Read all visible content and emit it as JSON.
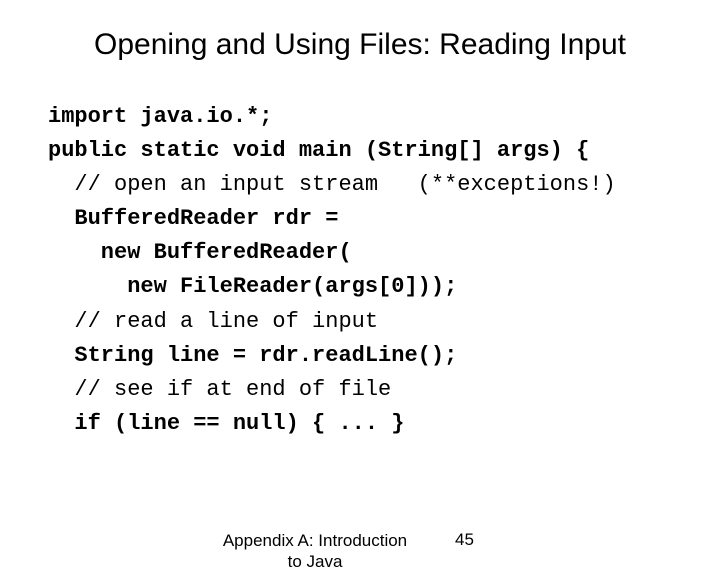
{
  "title": "Opening and Using Files: Reading Input",
  "code": {
    "l1": "import java.io.*;",
    "l2": "public static void main (String[] args) {",
    "l3": "  // open an input stream   (**exceptions!)",
    "l4": "  BufferedReader rdr =",
    "l5": "    new BufferedReader(",
    "l6": "      new FileReader(args[0]));",
    "l7": "  // read a line of input",
    "l8": "  String line = rdr.readLine();",
    "l9": "  // see if at end of file",
    "l10": "  if (line == null) { ... }"
  },
  "footer": {
    "text": "Appendix A: Introduction to Java",
    "page": "45"
  }
}
